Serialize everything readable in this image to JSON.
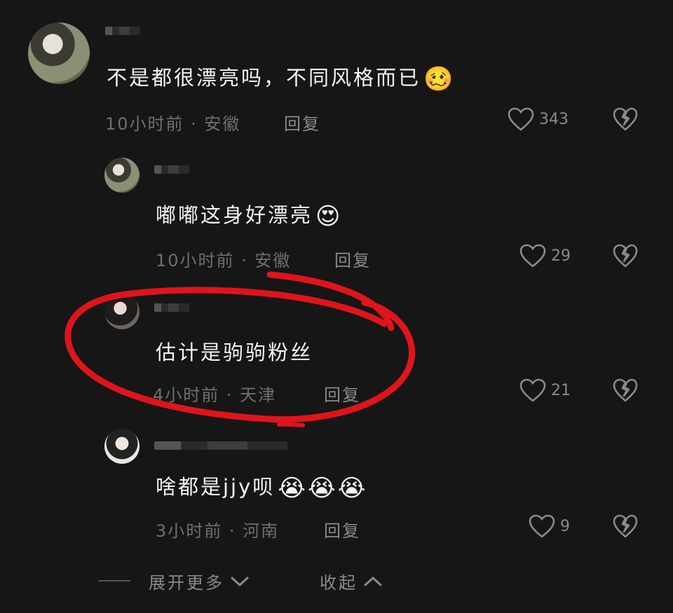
{
  "comments": [
    {
      "text": "不是都很漂亮吗，不同风格而已",
      "emoji": "🥴",
      "time_location": "10小时前 · 安徽",
      "reply_label": "回复",
      "likes": "343"
    },
    {
      "text": "嘟嘟这身好漂亮",
      "emoji": "😍",
      "time_location": "10小时前 · 安徽",
      "reply_label": "回复",
      "likes": "29"
    },
    {
      "text": "估计是驹驹粉丝",
      "emoji": "",
      "time_location": "4小时前 · 天津",
      "reply_label": "回复",
      "likes": "21"
    },
    {
      "text": "啥都是jjy呗",
      "emoji": "😭😭😭",
      "time_location": "3小时前 · 河南",
      "reply_label": "回复",
      "likes": "9"
    }
  ],
  "footer": {
    "expand_label": "展开更多",
    "collapse_label": "收起"
  },
  "colors": {
    "background": "#161616",
    "annotation_red": "#e0141b"
  },
  "icons": [
    "heart-icon",
    "broken-heart-icon",
    "chevron-down-icon",
    "chevron-up-icon"
  ]
}
